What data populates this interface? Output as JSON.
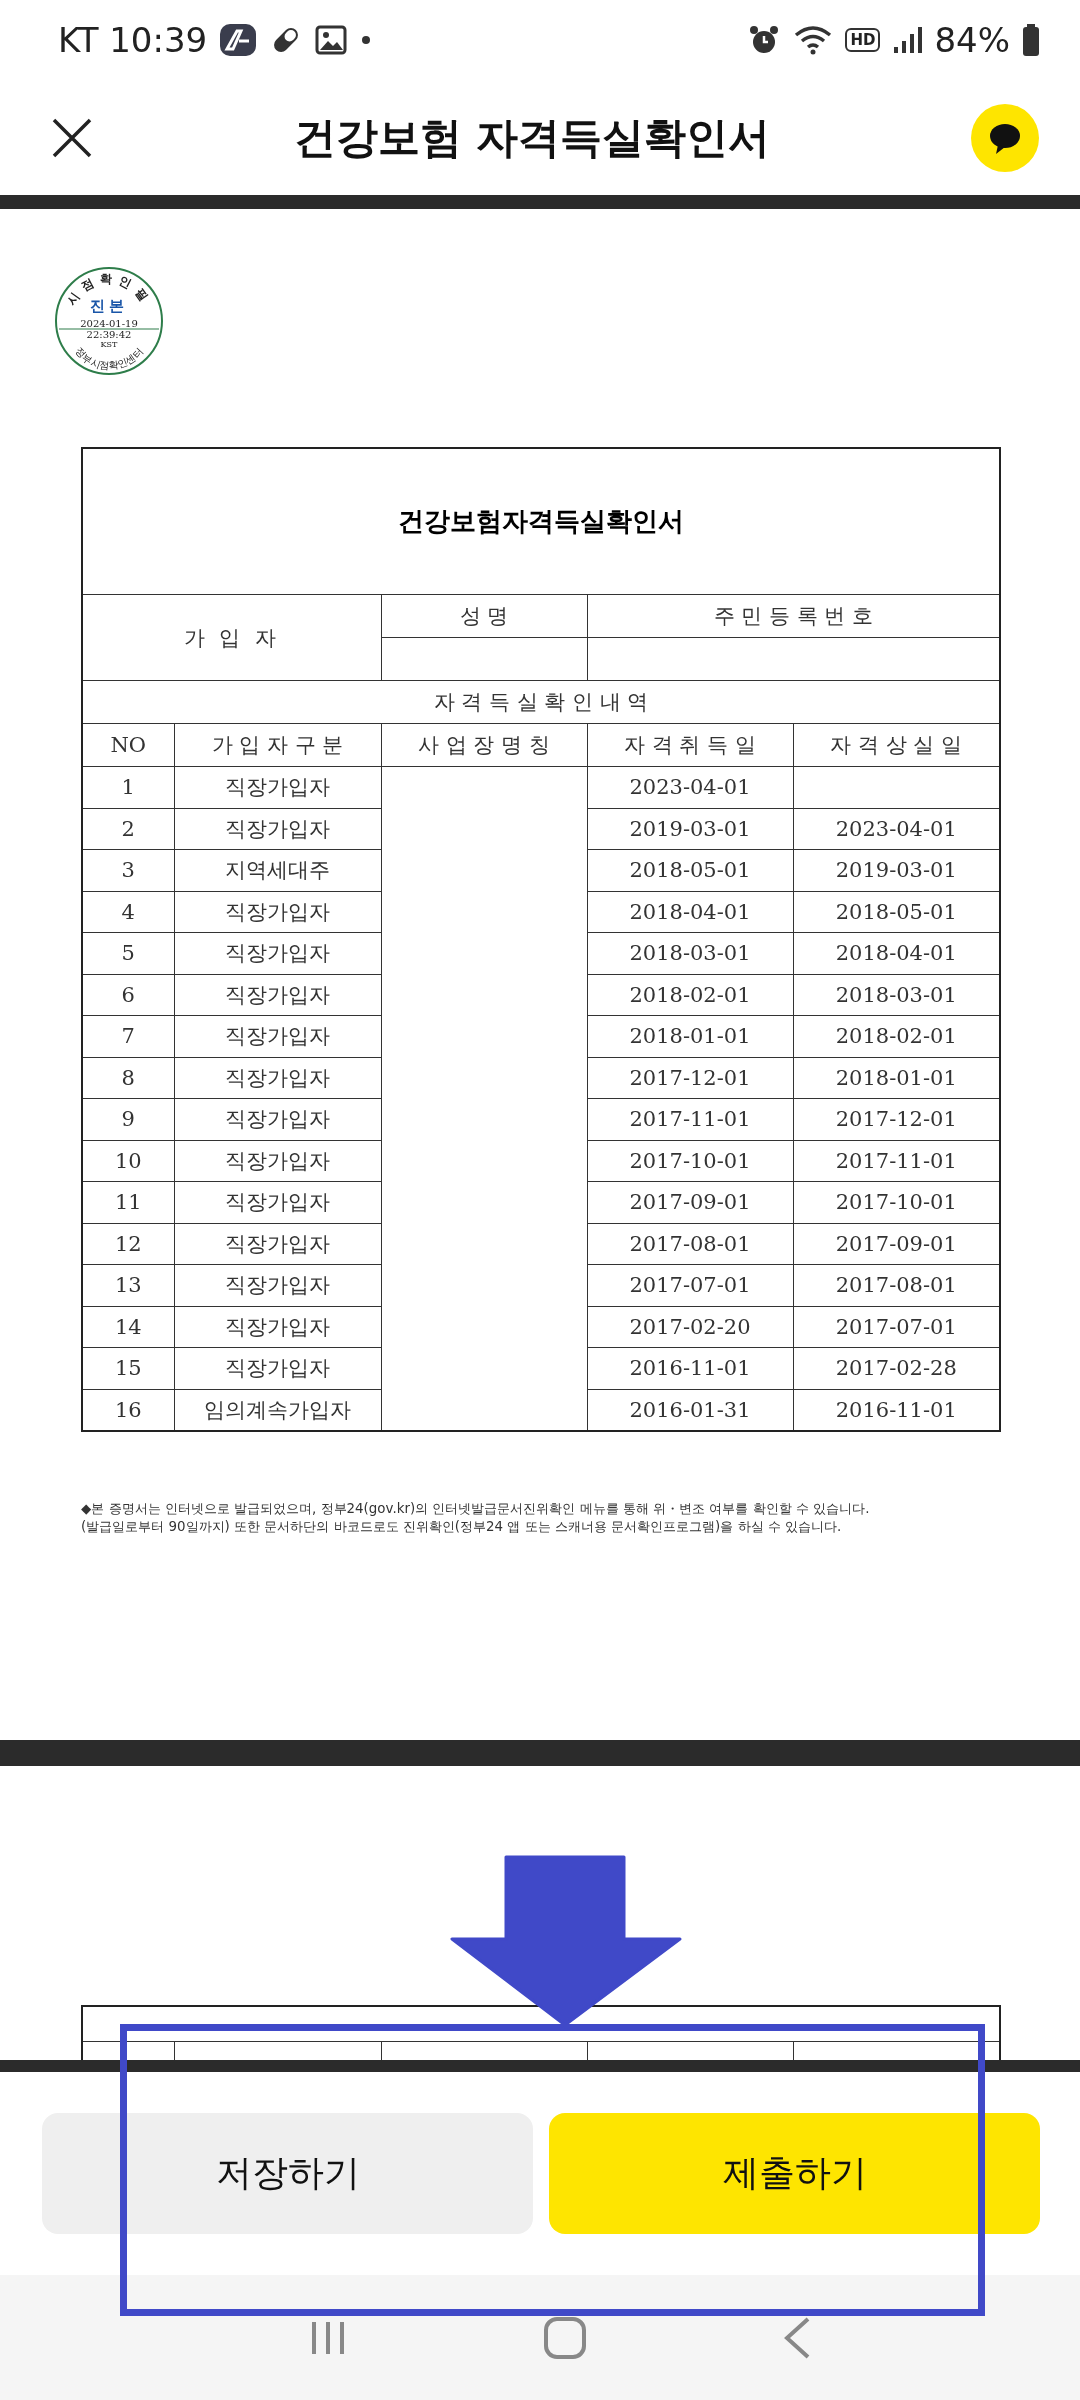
{
  "status_bar": {
    "carrier_time": "KT 10:39",
    "hd": "HD",
    "battery": "84%"
  },
  "header": {
    "title": "건강보험 자격득실확인서"
  },
  "stamp": {
    "top_arc": "시점확인필",
    "center": "진본",
    "date": "2024-01-19",
    "time": "22:39:42",
    "zone": "KST",
    "bottom_arc": "정부시점확인센터"
  },
  "document": {
    "title": "건강보험자격득실확인서",
    "subscriber_label": "가 입 자",
    "name_label": "성 명",
    "id_label": "주 민 등 록 번 호",
    "section_title": "자 격 득 실 확 인 내 역",
    "columns": [
      "NO",
      "가 입 자 구 분",
      "사 업 장 명 칭",
      "자 격 취 득 일",
      "자 격 상 실 일"
    ],
    "rows": [
      {
        "no": "1",
        "type": "직장가입자",
        "acquired": "2023-04-01"
      },
      {
        "no": "2",
        "type": "직장가입자",
        "acquired": "2019-03-01",
        "lost": "2023-04-01"
      },
      {
        "no": "3",
        "type": "지역세대주",
        "acquired": "2018-05-01",
        "lost": "2019-03-01"
      },
      {
        "no": "4",
        "type": "직장가입자",
        "acquired": "2018-04-01",
        "lost": "2018-05-01"
      },
      {
        "no": "5",
        "type": "직장가입자",
        "acquired": "2018-03-01",
        "lost": "2018-04-01"
      },
      {
        "no": "6",
        "type": "직장가입자",
        "acquired": "2018-02-01",
        "lost": "2018-03-01"
      },
      {
        "no": "7",
        "type": "직장가입자",
        "acquired": "2018-01-01",
        "lost": "2018-02-01"
      },
      {
        "no": "8",
        "type": "직장가입자",
        "acquired": "2017-12-01",
        "lost": "2018-01-01"
      },
      {
        "no": "9",
        "type": "직장가입자",
        "acquired": "2017-11-01",
        "lost": "2017-12-01"
      },
      {
        "no": "10",
        "type": "직장가입자",
        "acquired": "2017-10-01",
        "lost": "2017-11-01"
      },
      {
        "no": "11",
        "type": "직장가입자",
        "acquired": "2017-09-01",
        "lost": "2017-10-01"
      },
      {
        "no": "12",
        "type": "직장가입자",
        "acquired": "2017-08-01",
        "lost": "2017-09-01"
      },
      {
        "no": "13",
        "type": "직장가입자",
        "acquired": "2017-07-01",
        "lost": "2017-08-01"
      },
      {
        "no": "14",
        "type": "직장가입자",
        "acquired": "2017-02-20",
        "lost": "2017-07-01"
      },
      {
        "no": "15",
        "type": "직장가입자",
        "acquired": "2016-11-01",
        "lost": "2017-02-28"
      },
      {
        "no": "16",
        "type": "임의계속가입자",
        "acquired": "2016-01-31",
        "lost": "2016-11-01"
      }
    ],
    "notes": [
      "◆본 증명서는 인터넷으로 발급되었으며, 정부24(gov.kr)의 인터넷발급문서진위확인 메뉴를 통해 위・변조 여부를 확인할 수 있습니다.",
      "(발급일로부터 90일까지) 또한 문서하단의 바코드로도 진위확인(정부24 앱 또는 스캐너용 문서확인프로그램)을 하실 수 있습니다."
    ]
  },
  "next_page": {
    "kind": "table_top"
  },
  "actions": [
    {
      "label": "저장하기",
      "kind": "secondary"
    },
    {
      "label": "제출하기",
      "kind": "primary"
    }
  ]
}
